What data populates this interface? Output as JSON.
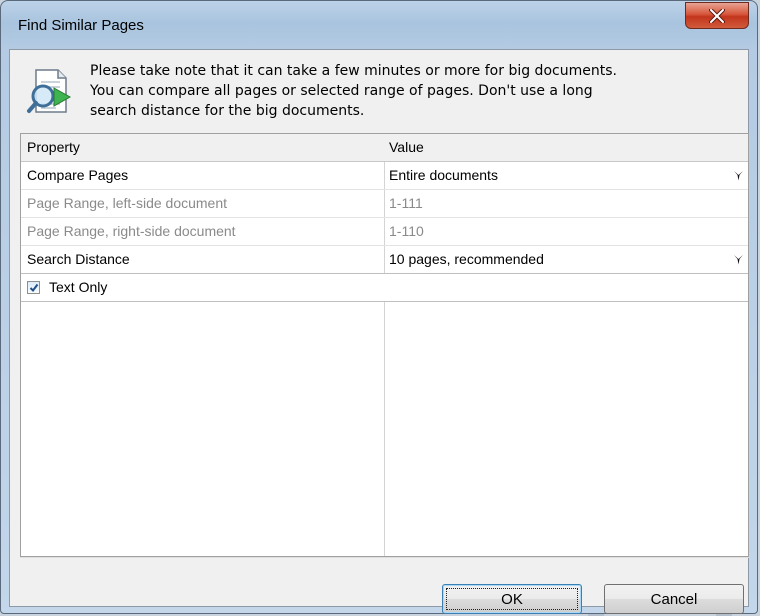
{
  "window": {
    "title": "Find Similar Pages"
  },
  "info": {
    "lines": [
      "Please take note that it can take a few minutes or more for big documents.",
      "You can compare all pages or selected range of pages. Don't use a long",
      "search distance for the big documents."
    ],
    "icon": "document-search-icon"
  },
  "grid": {
    "headers": {
      "property": "Property",
      "value": "Value"
    },
    "rows": [
      {
        "property": "Compare Pages",
        "value": "Entire documents",
        "enabled": true,
        "dropdown": true
      },
      {
        "property": "Page Range, left-side document",
        "value": "1-111",
        "enabled": false,
        "dropdown": false
      },
      {
        "property": "Page Range, right-side document",
        "value": "1-110",
        "enabled": false,
        "dropdown": false
      },
      {
        "property": "Search Distance",
        "value": "10 pages, recommended",
        "enabled": true,
        "dropdown": true
      }
    ],
    "text_only": {
      "label": "Text Only",
      "checked": true
    }
  },
  "buttons": {
    "ok": "OK",
    "cancel": "Cancel"
  },
  "colors": {
    "close_button": "#c73a22",
    "focus_border": "#3c7fb1"
  }
}
